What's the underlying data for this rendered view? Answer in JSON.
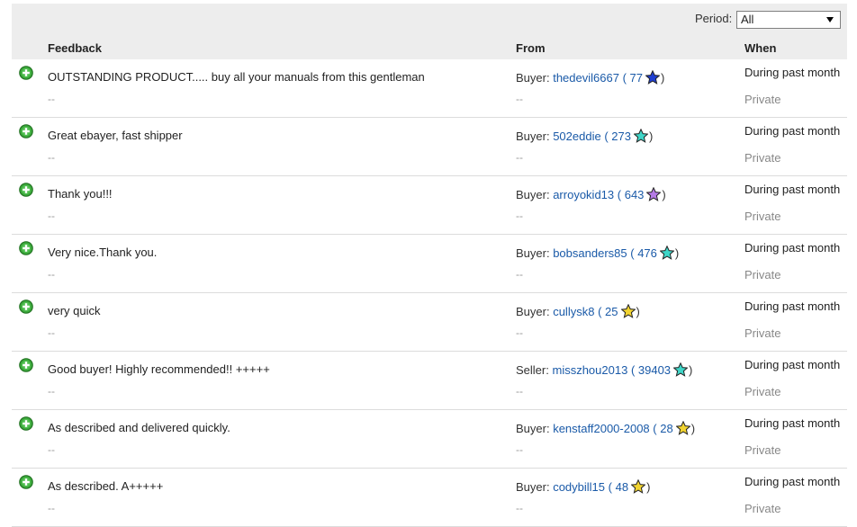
{
  "filter": {
    "label": "Period:",
    "selected": "All"
  },
  "columns": {
    "feedback": "Feedback",
    "from": "From",
    "when": "When"
  },
  "rows": [
    {
      "comment": "OUTSTANDING PRODUCT..... buy all your manuals from this gentleman",
      "role": "Buyer:",
      "user": "thedevil6667",
      "score": "77",
      "star_color": "#1f3fd1",
      "when": "During past month",
      "price": "Private",
      "reply": "--",
      "item": "--"
    },
    {
      "comment": "Great ebayer, fast shipper",
      "role": "Buyer:",
      "user": "502eddie",
      "score": "273",
      "star_color": "#3fd6c8",
      "when": "During past month",
      "price": "Private",
      "reply": "--",
      "item": "--"
    },
    {
      "comment": "Thank you!!!",
      "role": "Buyer:",
      "user": "arroyokid13",
      "score": "643",
      "star_color": "#b57be6",
      "when": "During past month",
      "price": "Private",
      "reply": "--",
      "item": "--"
    },
    {
      "comment": "Very nice.Thank you.",
      "role": "Buyer:",
      "user": "bobsanders85",
      "score": "476",
      "star_color": "#3fd6c8",
      "when": "During past month",
      "price": "Private",
      "reply": "--",
      "item": "--"
    },
    {
      "comment": "very quick",
      "role": "Buyer:",
      "user": "cullysk8",
      "score": "25",
      "star_color": "#f2d431",
      "when": "During past month",
      "price": "Private",
      "reply": "--",
      "item": "--"
    },
    {
      "comment": "Good buyer! Highly recommended!! +++++",
      "role": "Seller:",
      "user": "misszhou2013",
      "score": "39403",
      "star_color": "#3fd6c8",
      "when": "During past month",
      "price": "Private",
      "reply": "--",
      "item": "--"
    },
    {
      "comment": "As described and delivered quickly.",
      "role": "Buyer:",
      "user": "kenstaff2000-2008",
      "score": "28",
      "star_color": "#f2d431",
      "when": "During past month",
      "price": "Private",
      "reply": "--",
      "item": "--"
    },
    {
      "comment": "As described. A+++++",
      "role": "Buyer:",
      "user": "codybill15",
      "score": "48",
      "star_color": "#f2d431",
      "when": "During past month",
      "price": "Private",
      "reply": "--",
      "item": "--"
    }
  ]
}
